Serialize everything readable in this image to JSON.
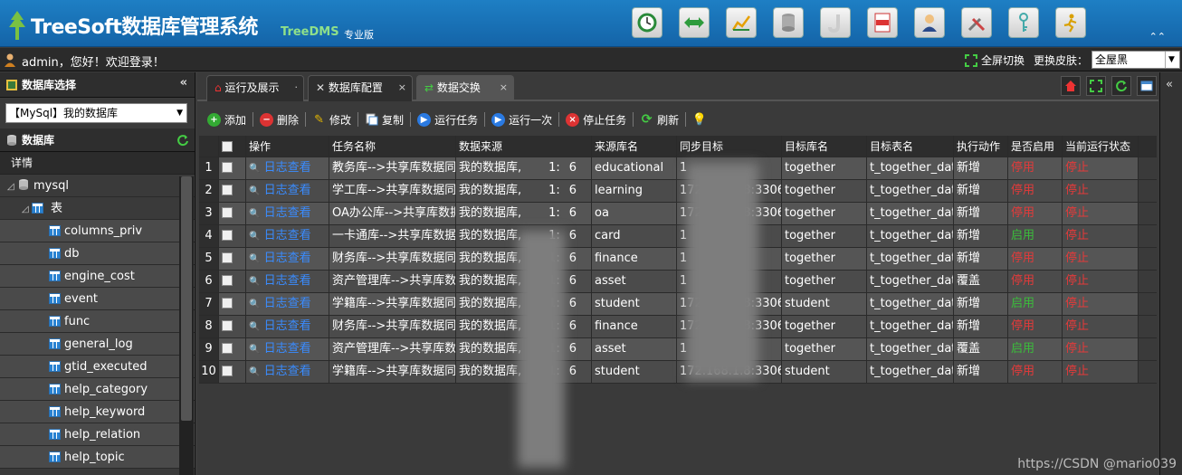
{
  "header": {
    "title": "TreeSoft数据库管理系统",
    "subtitle": "TreeDMS",
    "edition": "专业版",
    "tools": [
      "clock-icon",
      "arrows-icon",
      "chart-icon",
      "database-icon",
      "j-icon",
      "log-icon",
      "user-icon",
      "tools-icon",
      "key-icon",
      "run-icon"
    ]
  },
  "userbar": {
    "welcome": "admin，您好！欢迎登录！",
    "fullscreen": "全屏切换",
    "skin_label": "更换皮肤：",
    "skin_value": "全屋黑"
  },
  "sidebar": {
    "db_select_title": "数据库选择",
    "db_select_value": "【MySql】我的数据库",
    "db_section": "数据库",
    "detail": "详情",
    "root": "mysql",
    "table_node": "表",
    "tables": [
      "columns_priv",
      "db",
      "engine_cost",
      "event",
      "func",
      "general_log",
      "gtid_executed",
      "help_category",
      "help_keyword",
      "help_relation",
      "help_topic"
    ]
  },
  "tabs": [
    {
      "label": "运行及展示",
      "active": false
    },
    {
      "label": "数据库配置",
      "active": false
    },
    {
      "label": "数据交换",
      "active": true
    }
  ],
  "toolbar": {
    "add": "添加",
    "delete": "删除",
    "edit": "修改",
    "copy": "复制",
    "run_task": "运行任务",
    "run_once": "运行一次",
    "stop_task": "停止任务",
    "refresh": "刷新"
  },
  "grid": {
    "columns": [
      "操作",
      "任务名称",
      "数据来源",
      "来源库名",
      "同步目标",
      "目标库名",
      "目标表名",
      "执行动作",
      "是否启用",
      "当前运行状态"
    ],
    "log_link": "日志查看",
    "rows": [
      {
        "n": "1",
        "name": "教务库-->共享库数据同步",
        "source": "我的数据库,",
        "sport": "1:",
        "s6": "6",
        "srcdb": "educational",
        "target": "1",
        "tdb": "together",
        "ttable": "t_together_data",
        "action": "新增",
        "enabled": "停用",
        "status": "停止"
      },
      {
        "n": "2",
        "name": "学工库-->共享库数据同步",
        "source": "我的数据库,",
        "sport": "1:",
        "s6": "6",
        "srcdb": "learning",
        "target": "172.168.1.8:3306",
        "tdb": "together",
        "ttable": "t_together_data",
        "action": "新增",
        "enabled": "停用",
        "status": "停止"
      },
      {
        "n": "3",
        "name": "OA办公库-->共享库数据",
        "source": "我的数据库,",
        "sport": "1:",
        "s6": "6",
        "srcdb": "oa",
        "target": "172.168.1.8:3306",
        "tdb": "together",
        "ttable": "t_together_data",
        "action": "新增",
        "enabled": "停用",
        "status": "停止"
      },
      {
        "n": "4",
        "name": "一卡通库-->共享库数据",
        "source": "我的数据库,",
        "sport": "1:",
        "s6": "6",
        "srcdb": "card",
        "target": "1",
        "tdb": "together",
        "ttable": "t_together_data",
        "action": "新增",
        "enabled": "启用",
        "status": "停止"
      },
      {
        "n": "5",
        "name": "财务库-->共享库数据同步",
        "source": "我的数据库,",
        "sport": "1:",
        "s6": "6",
        "srcdb": "finance",
        "target": "1",
        "tdb": "together",
        "ttable": "t_together_data",
        "action": "新增",
        "enabled": "停用",
        "status": "停止"
      },
      {
        "n": "6",
        "name": "资产管理库-->共享库数据",
        "source": "我的数据库,",
        "sport": "1:",
        "s6": "6",
        "srcdb": "asset",
        "target": "1",
        "tdb": "together",
        "ttable": "t_together_data",
        "action": "覆盖",
        "enabled": "停用",
        "status": "停止"
      },
      {
        "n": "7",
        "name": "学籍库-->共享库数据同步",
        "source": "我的数据库,",
        "sport": "1:",
        "s6": "6",
        "srcdb": "student",
        "target": "172.168.1.8:3306",
        "tdb": "student",
        "ttable": "t_together_data",
        "action": "新增",
        "enabled": "启用",
        "status": "停止"
      },
      {
        "n": "8",
        "name": "财务库-->共享库数据同步",
        "source": "我的数据库,",
        "sport": "1:",
        "s6": "6",
        "srcdb": "finance",
        "target": "172.168.1.8:3306",
        "tdb": "together",
        "ttable": "t_together_data",
        "action": "新增",
        "enabled": "停用",
        "status": "停止"
      },
      {
        "n": "9",
        "name": "资产管理库-->共享库数据",
        "source": "我的数据库,",
        "sport": "1:",
        "s6": "6",
        "srcdb": "asset",
        "target": "1",
        "tdb": "together",
        "ttable": "t_together_data",
        "action": "覆盖",
        "enabled": "启用",
        "status": "停止"
      },
      {
        "n": "10",
        "name": "学籍库-->共享库数据同步",
        "source": "我的数据库,",
        "sport": "1:",
        "s6": "6",
        "srcdb": "student",
        "target": "172.168.1.8:3306",
        "tdb": "student",
        "ttable": "t_together_data",
        "action": "新增",
        "enabled": "停用",
        "status": "停止"
      }
    ]
  },
  "watermark": "https://CSDN @mario039",
  "colors": {
    "header_blue": "#1a74bb",
    "link": "#3a8cff",
    "stop_red": "#e43a3a",
    "enable_green": "#3bbd3b"
  }
}
